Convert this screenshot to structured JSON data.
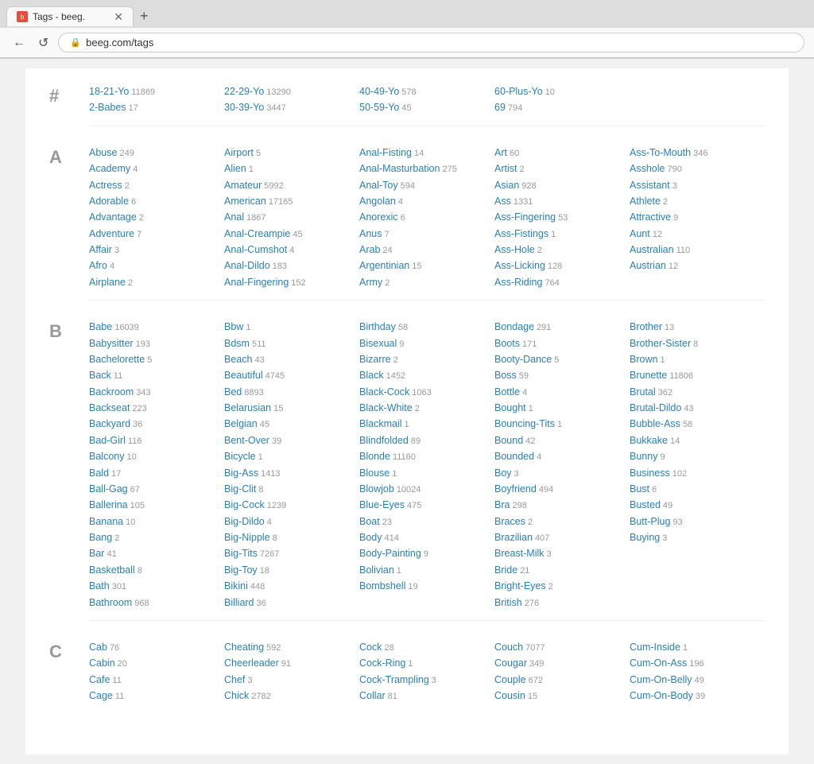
{
  "browser": {
    "tab_title": "Tags - beeg.",
    "tab_favicon": "b",
    "url": "beeg.com/tags",
    "new_tab_label": "+",
    "back_label": "←",
    "reload_label": "↺"
  },
  "sections": [
    {
      "letter": "#",
      "columns": [
        [
          {
            "name": "18-21-Yo",
            "count": "11869"
          },
          {
            "name": "2-Babes",
            "count": "17"
          }
        ],
        [
          {
            "name": "22-29-Yo",
            "count": "13290"
          },
          {
            "name": "30-39-Yo",
            "count": "3447"
          }
        ],
        [
          {
            "name": "40-49-Yo",
            "count": "578"
          },
          {
            "name": "50-59-Yo",
            "count": "45"
          }
        ],
        [
          {
            "name": "60-Plus-Yo",
            "count": "10"
          },
          {
            "name": "69",
            "count": "794"
          }
        ],
        []
      ]
    },
    {
      "letter": "A",
      "columns": [
        [
          {
            "name": "Abuse",
            "count": "249"
          },
          {
            "name": "Academy",
            "count": "4"
          },
          {
            "name": "Actress",
            "count": "2"
          },
          {
            "name": "Adorable",
            "count": "6"
          },
          {
            "name": "Advantage",
            "count": "2"
          },
          {
            "name": "Adventure",
            "count": "7"
          },
          {
            "name": "Affair",
            "count": "3"
          },
          {
            "name": "Afro",
            "count": "4"
          },
          {
            "name": "Airplane",
            "count": "2"
          }
        ],
        [
          {
            "name": "Airport",
            "count": "5"
          },
          {
            "name": "Alien",
            "count": "1"
          },
          {
            "name": "Amateur",
            "count": "5992"
          },
          {
            "name": "American",
            "count": "17165"
          },
          {
            "name": "Anal",
            "count": "1867"
          },
          {
            "name": "Anal-Creampie",
            "count": "45"
          },
          {
            "name": "Anal-Cumshot",
            "count": "4"
          },
          {
            "name": "Anal-Dildo",
            "count": "183"
          },
          {
            "name": "Anal-Fingering",
            "count": "152"
          }
        ],
        [
          {
            "name": "Anal-Fisting",
            "count": "14"
          },
          {
            "name": "Anal-Masturbation",
            "count": "275"
          },
          {
            "name": "Anal-Toy",
            "count": "594"
          },
          {
            "name": "Angolan",
            "count": "4"
          },
          {
            "name": "Anorexic",
            "count": "6"
          },
          {
            "name": "Anus",
            "count": "7"
          },
          {
            "name": "Arab",
            "count": "24"
          },
          {
            "name": "Argentinian",
            "count": "15"
          },
          {
            "name": "Army",
            "count": "2"
          }
        ],
        [
          {
            "name": "Art",
            "count": "60"
          },
          {
            "name": "Artist",
            "count": "2"
          },
          {
            "name": "Asian",
            "count": "928"
          },
          {
            "name": "Ass",
            "count": "1331"
          },
          {
            "name": "Ass-Fingering",
            "count": "53"
          },
          {
            "name": "Ass-Fistings",
            "count": "1"
          },
          {
            "name": "Ass-Hole",
            "count": "2"
          },
          {
            "name": "Ass-Licking",
            "count": "128"
          },
          {
            "name": "Ass-Riding",
            "count": "764"
          }
        ],
        [
          {
            "name": "Ass-To-Mouth",
            "count": "346"
          },
          {
            "name": "Asshole",
            "count": "790"
          },
          {
            "name": "Assistant",
            "count": "3"
          },
          {
            "name": "Athlete",
            "count": "2"
          },
          {
            "name": "Attractive",
            "count": "9"
          },
          {
            "name": "Aunt",
            "count": "12"
          },
          {
            "name": "Australian",
            "count": "110"
          },
          {
            "name": "Austrian",
            "count": "12"
          }
        ]
      ]
    },
    {
      "letter": "B",
      "columns": [
        [
          {
            "name": "Babe",
            "count": "16039"
          },
          {
            "name": "Babysitter",
            "count": "193"
          },
          {
            "name": "Bachelorette",
            "count": "5"
          },
          {
            "name": "Back",
            "count": "11"
          },
          {
            "name": "Backroom",
            "count": "343"
          },
          {
            "name": "Backseat",
            "count": "223"
          },
          {
            "name": "Backyard",
            "count": "36"
          },
          {
            "name": "Bad-Girl",
            "count": "116"
          },
          {
            "name": "Balcony",
            "count": "10"
          },
          {
            "name": "Bald",
            "count": "17"
          },
          {
            "name": "Ball-Gag",
            "count": "67"
          },
          {
            "name": "Ballerina",
            "count": "105"
          },
          {
            "name": "Banana",
            "count": "10"
          },
          {
            "name": "Bang",
            "count": "2"
          },
          {
            "name": "Bar",
            "count": "41"
          },
          {
            "name": "Basketball",
            "count": "8"
          },
          {
            "name": "Bath",
            "count": "301"
          },
          {
            "name": "Bathroom",
            "count": "968"
          }
        ],
        [
          {
            "name": "Bbw",
            "count": "1"
          },
          {
            "name": "Bdsm",
            "count": "511"
          },
          {
            "name": "Beach",
            "count": "43"
          },
          {
            "name": "Beautiful",
            "count": "4745"
          },
          {
            "name": "Bed",
            "count": "8893"
          },
          {
            "name": "Belarusian",
            "count": "15"
          },
          {
            "name": "Belgian",
            "count": "45"
          },
          {
            "name": "Bent-Over",
            "count": "39"
          },
          {
            "name": "Bicycle",
            "count": "1"
          },
          {
            "name": "Big-Ass",
            "count": "1413"
          },
          {
            "name": "Big-Clit",
            "count": "8"
          },
          {
            "name": "Big-Cock",
            "count": "1239"
          },
          {
            "name": "Big-Dildo",
            "count": "4"
          },
          {
            "name": "Big-Nipple",
            "count": "8"
          },
          {
            "name": "Big-Tits",
            "count": "7267"
          },
          {
            "name": "Big-Toy",
            "count": "18"
          },
          {
            "name": "Bikini",
            "count": "448"
          },
          {
            "name": "Billiard",
            "count": "36"
          }
        ],
        [
          {
            "name": "Birthday",
            "count": "58"
          },
          {
            "name": "Bisexual",
            "count": "9"
          },
          {
            "name": "Bizarre",
            "count": "2"
          },
          {
            "name": "Black",
            "count": "1452"
          },
          {
            "name": "Black-Cock",
            "count": "1063"
          },
          {
            "name": "Black-White",
            "count": "2"
          },
          {
            "name": "Blackmail",
            "count": "1"
          },
          {
            "name": "Blindfolded",
            "count": "89"
          },
          {
            "name": "Blonde",
            "count": "11160"
          },
          {
            "name": "Blouse",
            "count": "1"
          },
          {
            "name": "Blowjob",
            "count": "10024"
          },
          {
            "name": "Blue-Eyes",
            "count": "475"
          },
          {
            "name": "Boat",
            "count": "23"
          },
          {
            "name": "Body",
            "count": "414"
          },
          {
            "name": "Body-Painting",
            "count": "9"
          },
          {
            "name": "Bolivian",
            "count": "1"
          },
          {
            "name": "Bombshell",
            "count": "19"
          }
        ],
        [
          {
            "name": "Bondage",
            "count": "291"
          },
          {
            "name": "Boots",
            "count": "171"
          },
          {
            "name": "Booty-Dance",
            "count": "5"
          },
          {
            "name": "Boss",
            "count": "59"
          },
          {
            "name": "Bottle",
            "count": "4"
          },
          {
            "name": "Bought",
            "count": "1"
          },
          {
            "name": "Bouncing-Tits",
            "count": "1"
          },
          {
            "name": "Bound",
            "count": "42"
          },
          {
            "name": "Bounded",
            "count": "4"
          },
          {
            "name": "Boy",
            "count": "3"
          },
          {
            "name": "Boyfriend",
            "count": "494"
          },
          {
            "name": "Bra",
            "count": "298"
          },
          {
            "name": "Braces",
            "count": "2"
          },
          {
            "name": "Brazilian",
            "count": "407"
          },
          {
            "name": "Breast-Milk",
            "count": "3"
          },
          {
            "name": "Bride",
            "count": "21"
          },
          {
            "name": "Bright-Eyes",
            "count": "2"
          },
          {
            "name": "British",
            "count": "276"
          }
        ],
        [
          {
            "name": "Brother",
            "count": "13"
          },
          {
            "name": "Brother-Sister",
            "count": "8"
          },
          {
            "name": "Brown",
            "count": "1"
          },
          {
            "name": "Brunette",
            "count": "11806"
          },
          {
            "name": "Brutal",
            "count": "362"
          },
          {
            "name": "Brutal-Dildo",
            "count": "43"
          },
          {
            "name": "Bubble-Ass",
            "count": "58"
          },
          {
            "name": "Bukkake",
            "count": "14"
          },
          {
            "name": "Bunny",
            "count": "9"
          },
          {
            "name": "Business",
            "count": "102"
          },
          {
            "name": "Bust",
            "count": "6"
          },
          {
            "name": "Busted",
            "count": "49"
          },
          {
            "name": "Butt-Plug",
            "count": "93"
          },
          {
            "name": "Buying",
            "count": "3"
          }
        ]
      ]
    },
    {
      "letter": "C",
      "columns": [
        [
          {
            "name": "Cab",
            "count": "76"
          },
          {
            "name": "Cabin",
            "count": "20"
          },
          {
            "name": "Cafe",
            "count": "11"
          },
          {
            "name": "Cage",
            "count": "11"
          }
        ],
        [
          {
            "name": "Cheating",
            "count": "592"
          },
          {
            "name": "Cheerleader",
            "count": "91"
          },
          {
            "name": "Chef",
            "count": "3"
          },
          {
            "name": "Chick",
            "count": "2782"
          }
        ],
        [
          {
            "name": "Cock",
            "count": "28"
          },
          {
            "name": "Cock-Ring",
            "count": "1"
          },
          {
            "name": "Cock-Trampling",
            "count": "3"
          },
          {
            "name": "Collar",
            "count": "81"
          }
        ],
        [
          {
            "name": "Couch",
            "count": "7077"
          },
          {
            "name": "Cougar",
            "count": "349"
          },
          {
            "name": "Couple",
            "count": "672"
          },
          {
            "name": "Cousin",
            "count": "15"
          }
        ],
        [
          {
            "name": "Cum-Inside",
            "count": "1"
          },
          {
            "name": "Cum-On-Ass",
            "count": "196"
          },
          {
            "name": "Cum-On-Belly",
            "count": "49"
          },
          {
            "name": "Cum-On-Body",
            "count": "39"
          }
        ]
      ]
    }
  ]
}
